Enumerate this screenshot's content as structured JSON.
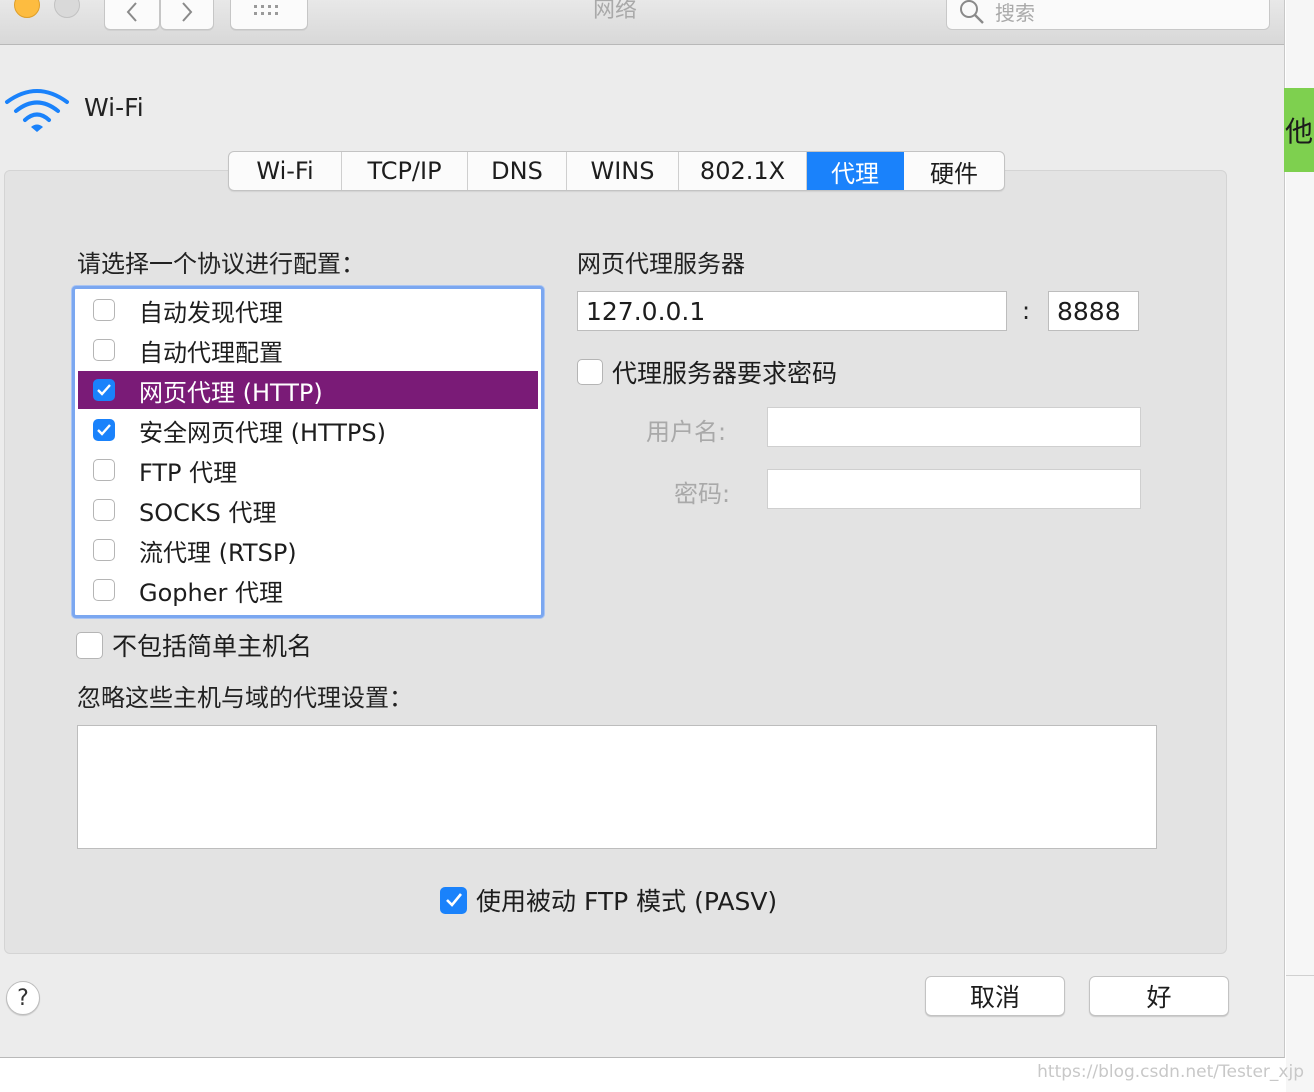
{
  "window": {
    "title": "网络"
  },
  "search": {
    "placeholder": "搜索"
  },
  "service": {
    "name": "Wi-Fi"
  },
  "tabs": [
    {
      "label": "Wi-Fi"
    },
    {
      "label": "TCP/IP"
    },
    {
      "label": "DNS"
    },
    {
      "label": "WINS"
    },
    {
      "label": "802.1X"
    },
    {
      "label": "代理",
      "active": true
    },
    {
      "label": "硬件"
    }
  ],
  "protocols": {
    "heading": "请选择一个协议进行配置：",
    "items": [
      {
        "label": "自动发现代理",
        "checked": false,
        "selected": false
      },
      {
        "label": "自动代理配置",
        "checked": false,
        "selected": false
      },
      {
        "label": "网页代理 (HTTP)",
        "checked": true,
        "selected": true
      },
      {
        "label": "安全网页代理 (HTTPS)",
        "checked": true,
        "selected": false
      },
      {
        "label": "FTP 代理",
        "checked": false,
        "selected": false
      },
      {
        "label": "SOCKS 代理",
        "checked": false,
        "selected": false
      },
      {
        "label": "流代理 (RTSP)",
        "checked": false,
        "selected": false
      },
      {
        "label": "Gopher 代理",
        "checked": false,
        "selected": false
      }
    ]
  },
  "proxy_server": {
    "heading": "网页代理服务器",
    "host": "127.0.0.1",
    "separator": ":",
    "port": "8888",
    "require_password_label": "代理服务器要求密码",
    "require_password": false,
    "username_label": "用户名:",
    "username": "",
    "password_label": "密码:",
    "password": ""
  },
  "exclude_simple_hostnames": {
    "label": "不包括简单主机名",
    "checked": false
  },
  "bypass": {
    "label": "忽略这些主机与域的代理设置：",
    "value": ""
  },
  "pasv": {
    "label": "使用被动 FTP 模式 (PASV)",
    "checked": true
  },
  "buttons": {
    "help": "?",
    "cancel": "取消",
    "ok": "好"
  },
  "side": {
    "tag_text": "他"
  },
  "watermark": "https://blog.csdn.net/Tester_xjp",
  "colors": {
    "accent": "#1a82fb",
    "selection": "#7a1b77",
    "focus_ring": "#7ba7f0",
    "green_tag": "#7ed04f"
  }
}
